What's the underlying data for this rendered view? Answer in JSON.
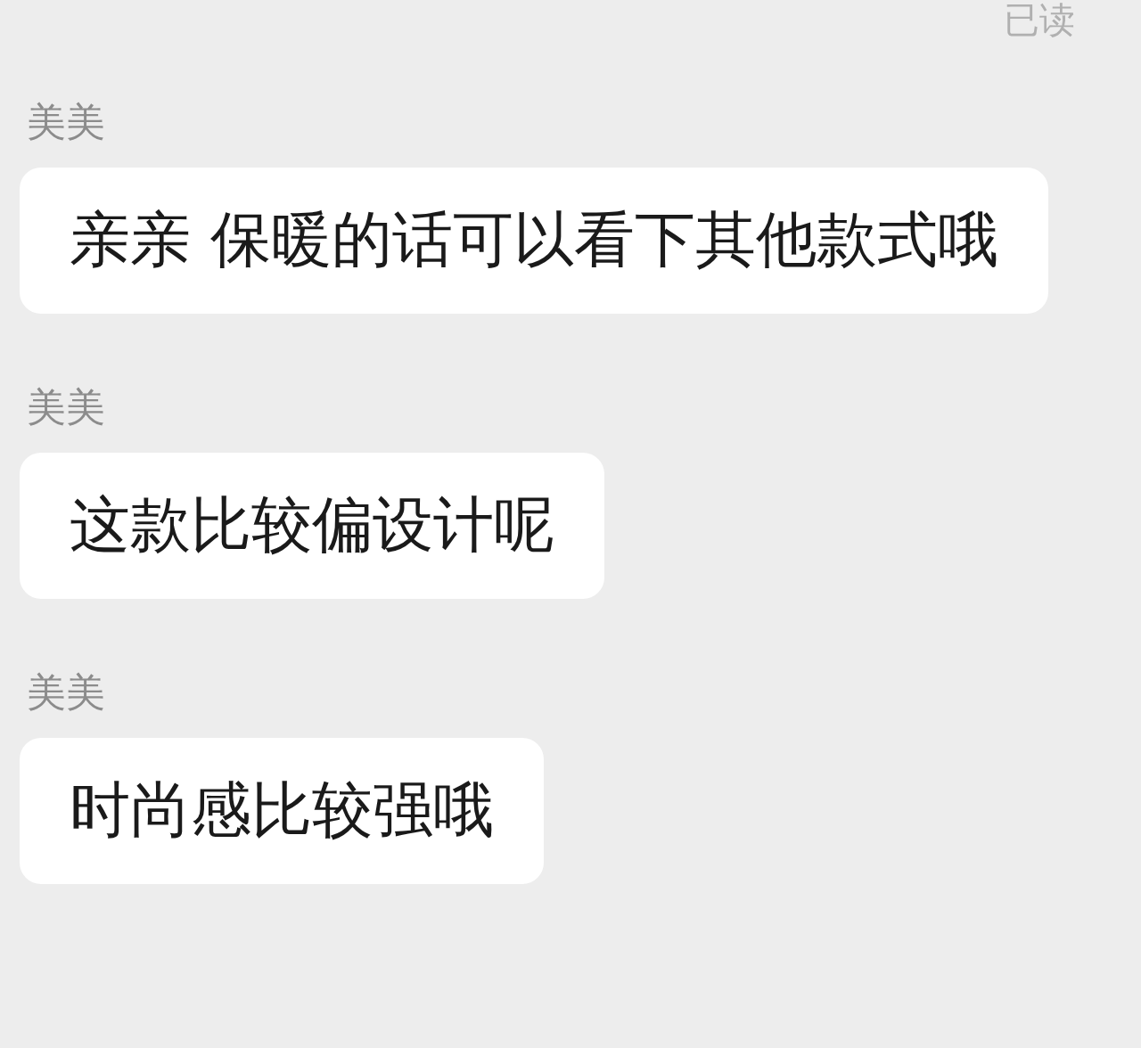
{
  "read_status": "已读",
  "messages": [
    {
      "sender": "美美",
      "text": "亲亲 保暖的话可以看下其他款式哦"
    },
    {
      "sender": "美美",
      "text": "这款比较偏设计呢"
    },
    {
      "sender": "美美",
      "text": "时尚感比较强哦"
    }
  ]
}
